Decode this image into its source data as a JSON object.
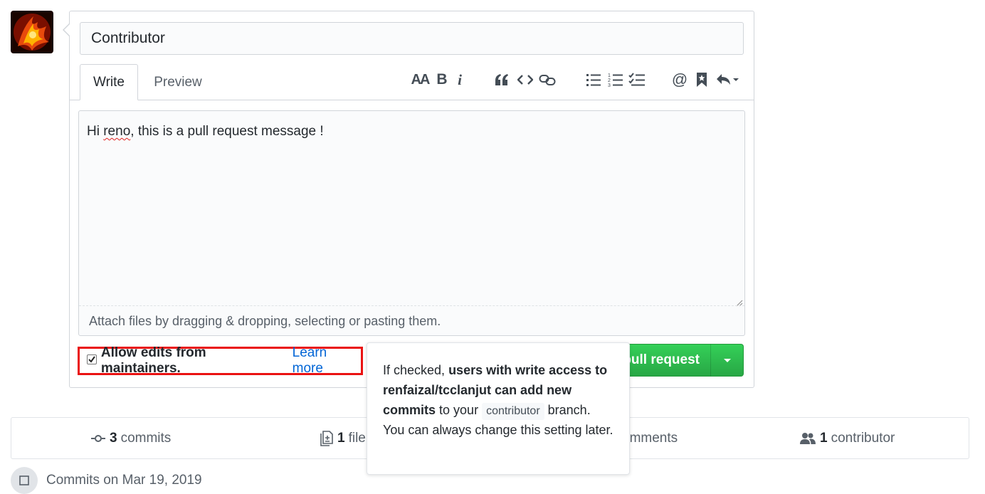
{
  "pr_form": {
    "title_value": "Contributor",
    "tabs": {
      "write": "Write",
      "preview": "Preview"
    },
    "toolbar": {
      "heading_glyph": "AA",
      "bold_glyph": "B",
      "italic_glyph": "i",
      "icons": [
        "text-size-icon",
        "bold-icon",
        "italic-icon",
        "quote-icon",
        "code-icon",
        "link-icon",
        "bulleted-list-icon",
        "numbered-list-icon",
        "task-list-icon",
        "mention-icon",
        "saved-reply-icon",
        "reply-icon"
      ]
    },
    "body": {
      "prefix": "Hi ",
      "misspelled": "reno",
      "suffix": ", this is a pull request message !"
    },
    "attach_text": "Attach files by dragging & dropping, selecting or pasting them.",
    "allow_edits": {
      "checked": true,
      "label": "Allow edits from maintainers.",
      "link": "Learn more"
    },
    "create_button_visible_text": "pull request"
  },
  "tooltip": {
    "part1": "If checked, ",
    "bold": "users with write access to renfaizal/tcclanjut can add new commits",
    "part2": " to your ",
    "branch": "contributor",
    "part3": " branch. You can always change this setting later."
  },
  "stats": {
    "commits": {
      "count": "3",
      "label": "commits"
    },
    "files": {
      "count": "1",
      "label": "file"
    },
    "comments": {
      "label": "omments"
    },
    "contributors": {
      "count": "1",
      "label": "contributor"
    }
  },
  "commits_header": "Commits on Mar 19, 2019",
  "colors": {
    "green": "#28a745",
    "link_blue": "#0366d6",
    "highlight_red": "#ea1212",
    "border": "#d1d5da"
  }
}
